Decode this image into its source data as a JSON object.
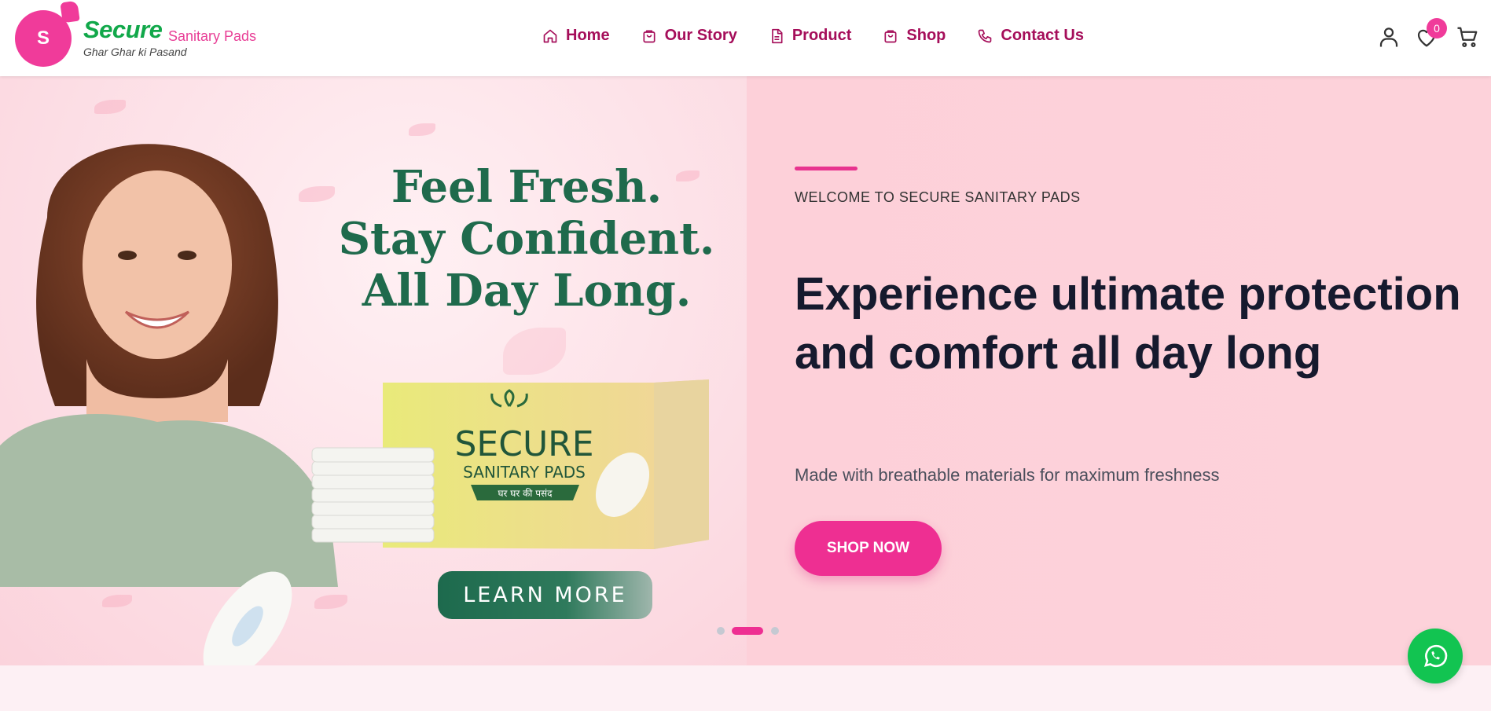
{
  "header": {
    "logo_letter": "S",
    "brand_name": "Secure",
    "brand_sub": "Sanitary Pads",
    "brand_tagline": "Ghar Ghar ki Pasand",
    "nav": [
      {
        "label": "Home",
        "icon": "home-icon"
      },
      {
        "label": "Our Story",
        "icon": "bag-icon"
      },
      {
        "label": "Product",
        "icon": "document-icon"
      },
      {
        "label": "Shop",
        "icon": "bag-icon"
      },
      {
        "label": "Contact Us",
        "icon": "phone-icon"
      }
    ],
    "wishlist_count": "0",
    "icons": [
      "user-icon",
      "heart-icon",
      "cart-icon"
    ]
  },
  "hero": {
    "art_headline": [
      "Feel Fresh.",
      "Stay Confident.",
      "All Day Long."
    ],
    "product_box": {
      "brand": "SECURE",
      "line": "SANITARY PADS",
      "tag": "घर घर की पसंद"
    },
    "learn_more": "LEARN MORE",
    "welcome": "WELCOME TO SECURE SANITARY PADS",
    "title": "Experience ultimate protection and comfort all day long",
    "description": "Made with breathable materials for maximum freshness",
    "cta": "SHOP NOW",
    "slides": 3,
    "active_slide": 2
  },
  "colors": {
    "primary_pink": "#ee2f92",
    "brand_green": "#11a84a",
    "nav_text": "#a50e5a",
    "hero_bg": "#fdd2da",
    "headline_green": "#1f6a4c",
    "whatsapp_green": "#12c451"
  },
  "floating": {
    "icon": "whatsapp-icon"
  }
}
